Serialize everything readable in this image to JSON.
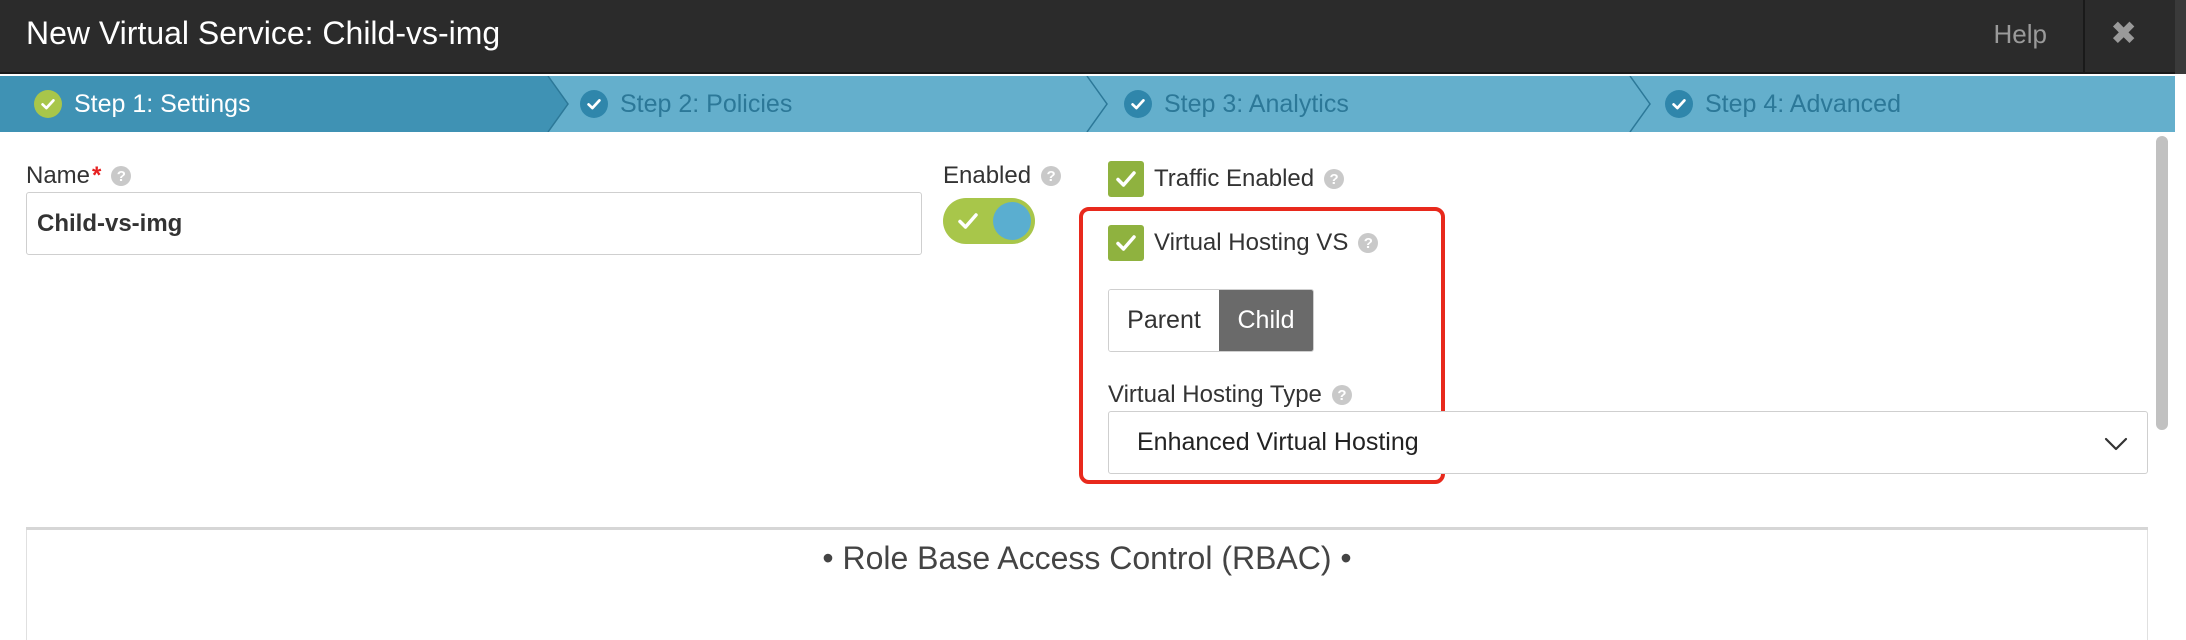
{
  "header": {
    "title": "New Virtual Service: Child-vs-img",
    "help_label": "Help",
    "close_glyph": "✖"
  },
  "steps": [
    {
      "label": "Step 1: Settings",
      "active": true
    },
    {
      "label": "Step 2: Policies",
      "active": false
    },
    {
      "label": "Step 3: Analytics",
      "active": false
    },
    {
      "label": "Step 4: Advanced",
      "active": false
    }
  ],
  "form": {
    "name_label": "Name",
    "required_mark": "*",
    "name_value": "Child-vs-img",
    "enabled_label": "Enabled",
    "enabled_on": true,
    "traffic_enabled_label": "Traffic Enabled",
    "traffic_enabled_checked": true,
    "virtual_hosting_label": "Virtual Hosting VS",
    "virtual_hosting_checked": true,
    "vh_role_options": [
      "Parent",
      "Child"
    ],
    "vh_role_selected": "Child",
    "vh_type_label": "Virtual Hosting Type",
    "vh_type_value": "Enhanced Virtual Hosting",
    "help_glyph": "?"
  },
  "rbac": {
    "title": "• Role Base Access Control (RBAC) •"
  },
  "colors": {
    "header_bg": "#2b2b2b",
    "steps_bg": "#64afcc",
    "active_step_bg": "#3f92b4",
    "check_green": "#8fb23f",
    "highlight_red": "#e8291c"
  },
  "icons": {
    "close": "close-icon",
    "step_check": "check-circle-icon",
    "help": "question-circle-icon",
    "dropdown": "chevron-down-icon"
  }
}
